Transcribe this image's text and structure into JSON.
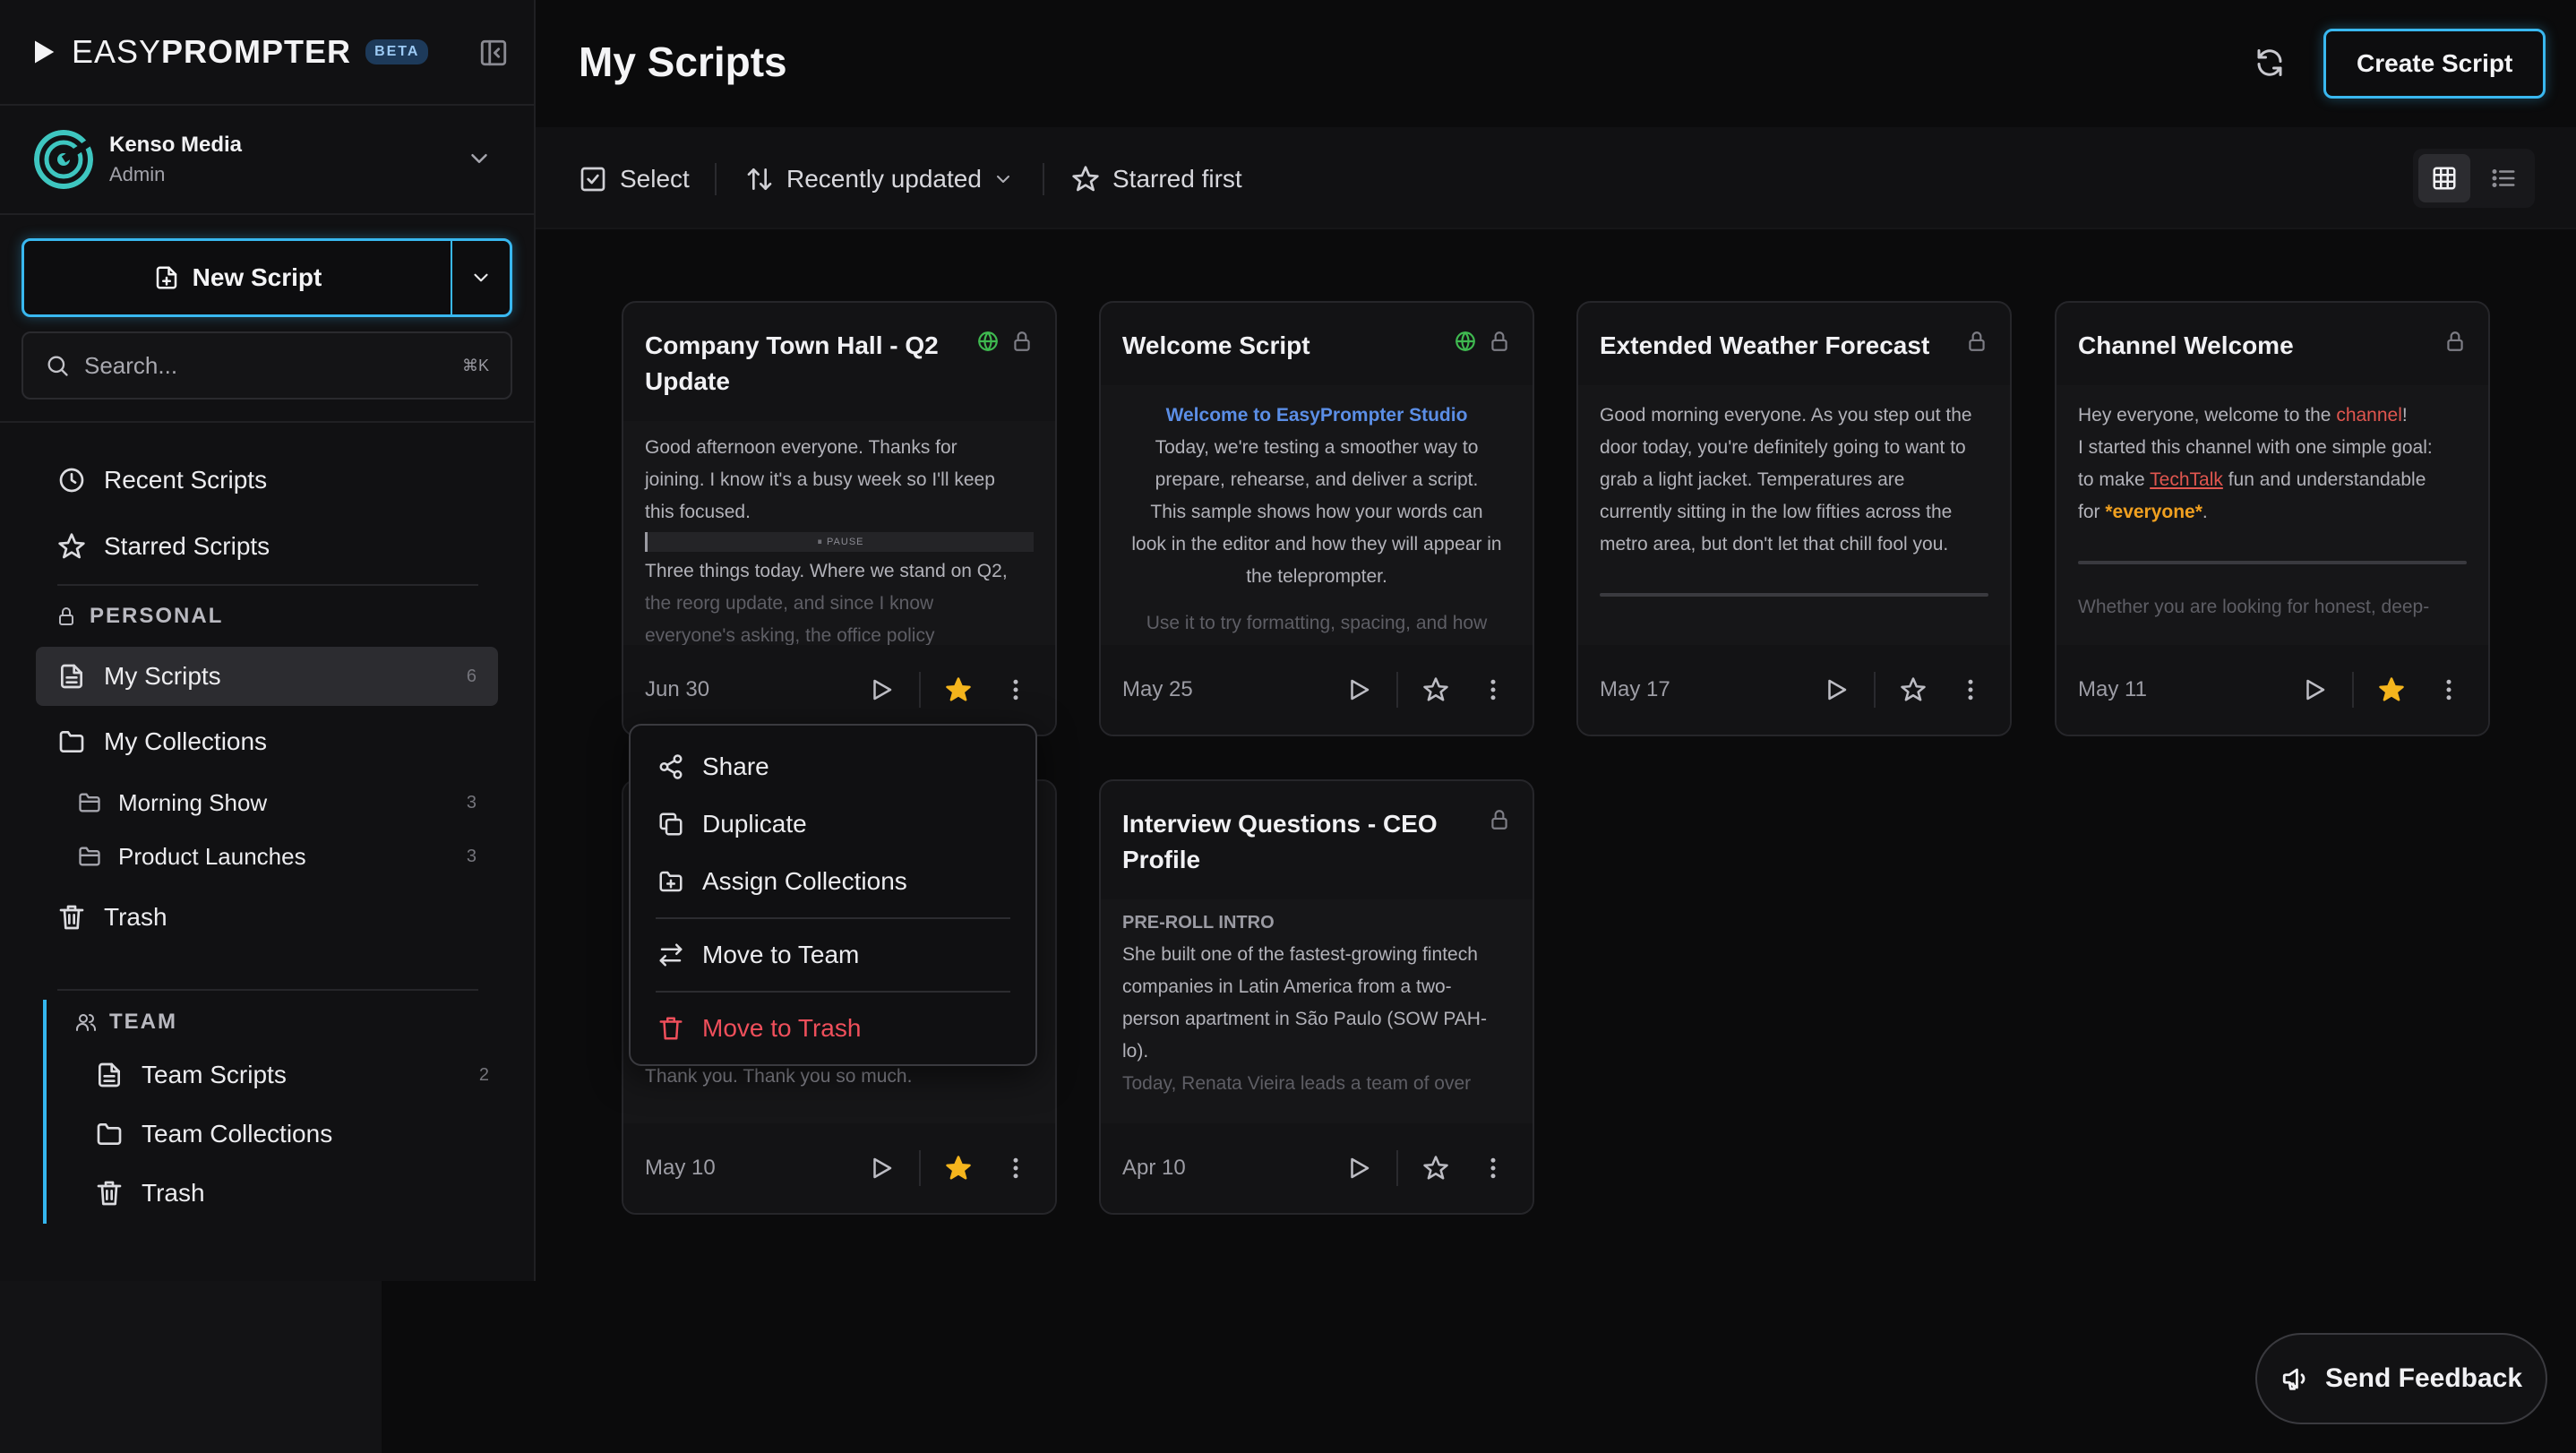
{
  "app": {
    "brand_light": "EASY",
    "brand_bold": "PROMPTER",
    "badge": "BETA"
  },
  "account": {
    "name": "Kenso Media",
    "role": "Admin"
  },
  "sidebar": {
    "new_script": "New Script",
    "search_placeholder": "Search...",
    "search_shortcut": "⌘K",
    "recent": "Recent Scripts",
    "starred": "Starred Scripts",
    "personal_label": "PERSONAL",
    "my_scripts": "My Scripts",
    "my_scripts_count": "6",
    "my_collections": "My Collections",
    "collections": [
      {
        "label": "Morning Show",
        "count": "3"
      },
      {
        "label": "Product Launches",
        "count": "3"
      }
    ],
    "trash": "Trash",
    "team_label": "TEAM",
    "team_scripts": "Team Scripts",
    "team_scripts_count": "2",
    "team_collections": "Team Collections",
    "team_trash": "Trash"
  },
  "header": {
    "title": "My Scripts",
    "create": "Create Script"
  },
  "toolbar": {
    "select": "Select",
    "sort": "Recently updated",
    "starred_first": "Starred first"
  },
  "cards": [
    {
      "title": "Company Town Hall - Q2 Update",
      "date": "Jun 30",
      "l1": "Good afternoon everyone. Thanks for",
      "l2": "joining. I know it's a busy week so I'll keep",
      "l3": "this focused.",
      "pause": "⏸ PAUSE",
      "l4": "Three things today. Where we stand on Q2,",
      "l5": "the reorg update, and since I know",
      "l6": "everyone's asking, the office policy"
    },
    {
      "title": "Welcome Script",
      "date": "May 25",
      "heading": "Welcome to EasyPrompter Studio",
      "l1": "Today, we're testing a smoother way to",
      "l2": "prepare, rehearse, and deliver a script.",
      "l3": "This sample shows how your words can",
      "l4": "look in the editor and how they will appear in",
      "l5": "the teleprompter.",
      "l6": "Use it to try formatting, spacing, and how"
    },
    {
      "title": "Extended Weather Forecast",
      "date": "May 17",
      "l1": "Good morning everyone. As you step out the",
      "l2": "door today, you're definitely going to want to",
      "l3": "grab a light jacket. Temperatures are",
      "l4": "currently sitting in the low fifties across the",
      "l5": "metro area, but don't let that chill fool you."
    },
    {
      "title": "Channel Welcome",
      "date": "May 11",
      "l1a": "Hey everyone, welcome to the ",
      "l1b": "channel",
      "l1c": "!",
      "l2": "I started this channel with one simple goal:",
      "l3a": "to make ",
      "l3b": "TechTalk",
      "l3c": " fun and understandable",
      "l4a": "for ",
      "l4b": "*everyone*",
      "l4c": ".",
      "l5": "Whether you are looking for honest, deep-"
    },
    {
      "date": "May 10",
      "l1": "Thank you. Thank you so much."
    },
    {
      "title": "Interview Questions - CEO Profile",
      "date": "Apr 10",
      "heading": "PRE-ROLL INTRO",
      "l1": "She built one of the fastest-growing fintech",
      "l2": "companies in Latin America from a two-",
      "l3": "person apartment in São Paulo (SOW PAH-",
      "l4": "lo).",
      "l5": "Today, Renata Vieira leads a team of over"
    }
  ],
  "menu": {
    "share": "Share",
    "duplicate": "Duplicate",
    "assign": "Assign Collections",
    "move_team": "Move to Team",
    "move_trash": "Move to Trash"
  },
  "feedback": "Send Feedback",
  "colors": {
    "accent": "#39b8f0",
    "star": "#f5b51d",
    "danger": "#ef4f5b",
    "globe": "#3fb950"
  },
  "icons": [
    "play-icon",
    "sidebar-toggle-icon",
    "chevron-down-icon",
    "new-file-icon",
    "search-icon",
    "clock-icon",
    "star-icon",
    "lock-icon",
    "document-icon",
    "folder-icon",
    "folder-outline-icon",
    "trash-icon",
    "users-icon",
    "refresh-icon",
    "checkbox-icon",
    "sort-icon",
    "grid-icon",
    "list-icon",
    "globe-icon",
    "kebab-icon",
    "share-icon",
    "duplicate-icon",
    "folder-plus-icon",
    "transfer-icon",
    "megaphone-icon"
  ]
}
